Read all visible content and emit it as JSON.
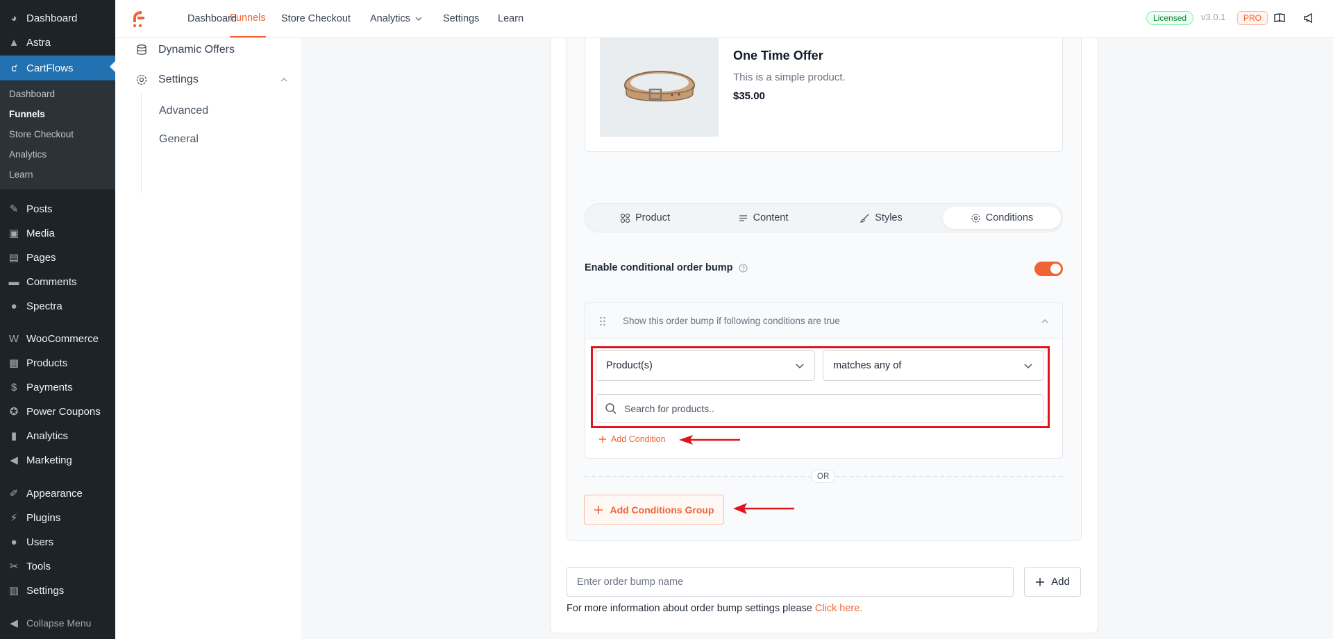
{
  "wp_menu": {
    "items": [
      {
        "label": "Dashboard",
        "icon": "dashboard-icon",
        "glyph": "◕"
      },
      {
        "label": "Astra",
        "icon": "astra-icon",
        "glyph": "▲"
      },
      {
        "label": "CartFlows",
        "icon": "cartflows-icon",
        "glyph": "ƈ"
      },
      {
        "label": "Posts",
        "icon": "pin-icon",
        "glyph": "✎"
      },
      {
        "label": "Media",
        "icon": "media-icon",
        "glyph": "▣"
      },
      {
        "label": "Pages",
        "icon": "pages-icon",
        "glyph": "▤"
      },
      {
        "label": "Comments",
        "icon": "comments-icon",
        "glyph": "▬"
      },
      {
        "label": "Spectra",
        "icon": "spectra-icon",
        "glyph": "●"
      },
      {
        "label": "WooCommerce",
        "icon": "woocommerce-icon",
        "glyph": "W"
      },
      {
        "label": "Products",
        "icon": "products-icon",
        "glyph": "▦"
      },
      {
        "label": "Payments",
        "icon": "payments-icon",
        "glyph": "$"
      },
      {
        "label": "Power Coupons",
        "icon": "coupons-icon",
        "glyph": "✪"
      },
      {
        "label": "Analytics",
        "icon": "analytics-icon",
        "glyph": "▮"
      },
      {
        "label": "Marketing",
        "icon": "megaphone-icon",
        "glyph": "◀"
      },
      {
        "label": "Appearance",
        "icon": "brush-icon",
        "glyph": "✐"
      },
      {
        "label": "Plugins",
        "icon": "plug-icon",
        "glyph": "⚡"
      },
      {
        "label": "Users",
        "icon": "user-icon",
        "glyph": "●"
      },
      {
        "label": "Tools",
        "icon": "wrench-icon",
        "glyph": "✂"
      },
      {
        "label": "Settings",
        "icon": "sliders-icon",
        "glyph": "▥"
      }
    ],
    "submenu": [
      "Dashboard",
      "Funnels",
      "Store Checkout",
      "Analytics",
      "Learn"
    ],
    "collapse_label": "Collapse Menu"
  },
  "topbar": {
    "nav": [
      "Dashboard",
      "Funnels",
      "Store Checkout",
      "Analytics",
      "Settings",
      "Learn"
    ],
    "licensed": "Licensed",
    "version": "v3.0.1",
    "pro": "PRO"
  },
  "settings_side": {
    "dynamic_offers": "Dynamic Offers",
    "settings": "Settings",
    "advanced": "Advanced",
    "general": "General"
  },
  "product": {
    "title": "One Time Offer",
    "description": "This is a simple product.",
    "price": "$35.00"
  },
  "tabs": [
    "Product",
    "Content",
    "Styles",
    "Conditions"
  ],
  "conditions": {
    "enable_label": "Enable conditional order bump",
    "enabled": true,
    "group_header": "Show this order bump if following conditions are true",
    "field_select": "Product(s)",
    "operator_select": "matches any of",
    "search_placeholder": "Search for products..",
    "add_condition": "Add Condition",
    "or_label": "OR",
    "add_group": "Add Conditions Group"
  },
  "footer": {
    "bump_name_placeholder": "Enter order bump name",
    "add_label": "Add",
    "info_text": "For more information about order bump settings please ",
    "info_link": "Click here."
  },
  "colors": {
    "accent": "#f06335",
    "wp_active": "#2271b1",
    "highlight": "#e0141e"
  }
}
